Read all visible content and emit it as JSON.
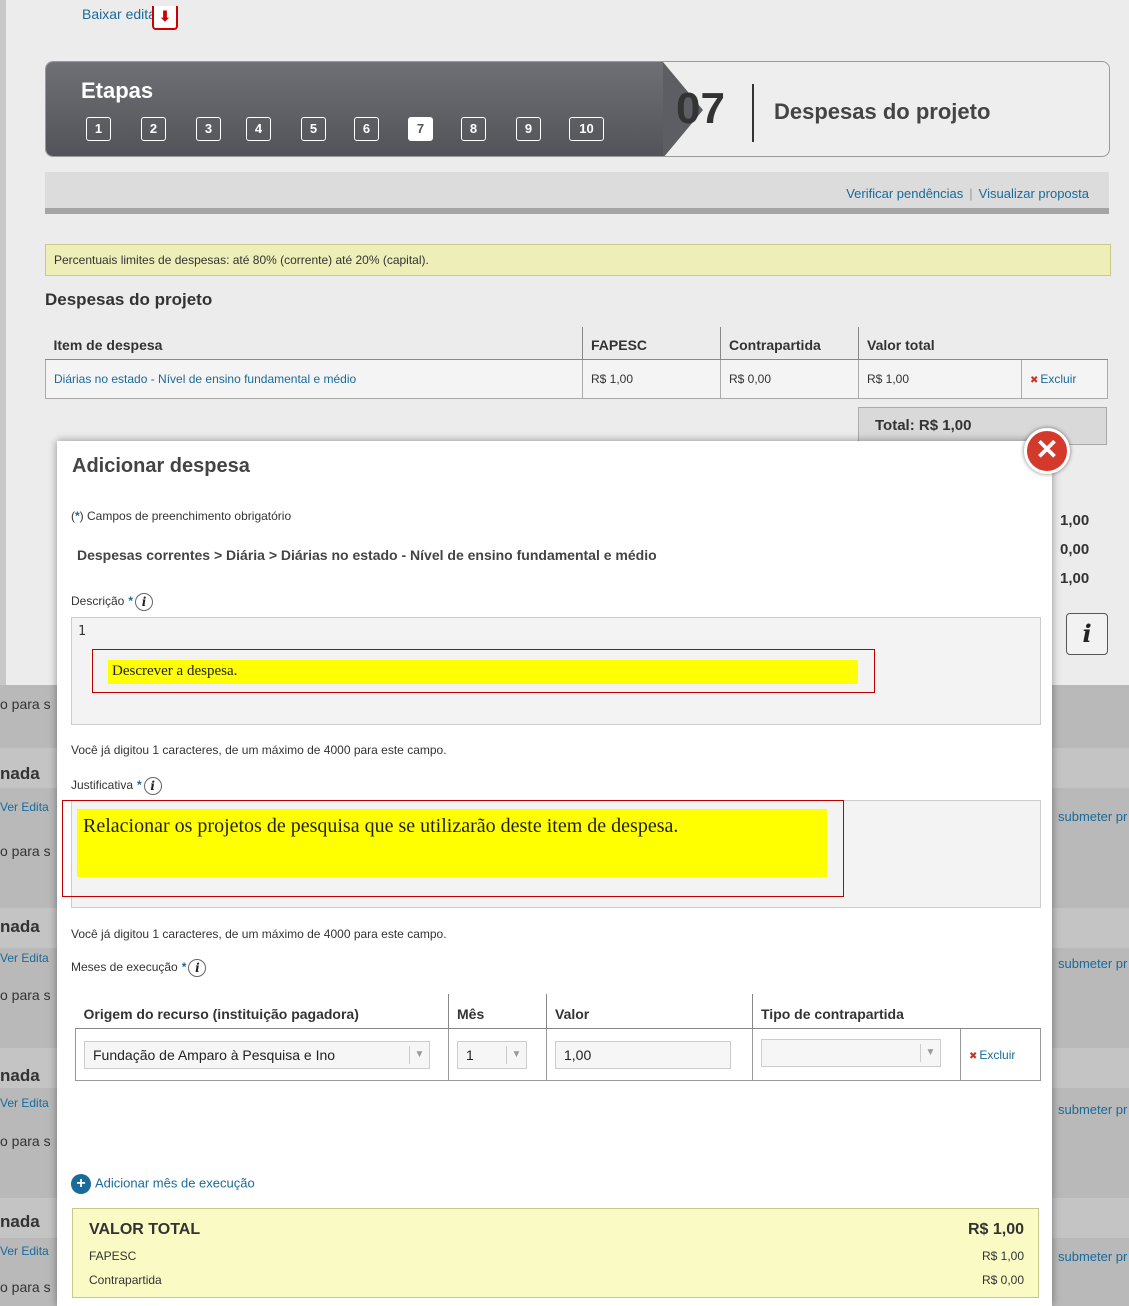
{
  "page": {
    "baixar_edital": "Baixar edital",
    "etapas": {
      "title": "Etapas",
      "steps": [
        "1",
        "2",
        "3",
        "4",
        "5",
        "6",
        "7",
        "8",
        "9",
        "10"
      ],
      "current_number": "07",
      "current_name": "Despesas do projeto"
    },
    "pendencias": {
      "verificar": "Verificar pendências",
      "separator": "|",
      "visualizar": "Visualizar proposta"
    },
    "notice": "Percentuais limites de despesas: até 80% (corrente) até 20% (capital).",
    "section_title": "Despesas do projeto",
    "table": {
      "headers": [
        "Item de despesa",
        "FAPESC",
        "Contrapartida",
        "Valor total"
      ],
      "row": {
        "item": "Diárias no estado - Nível de ensino fundamental e médio",
        "fapesc": "R$ 1,00",
        "contrapartida": "R$ 0,00",
        "valor_total": "R$ 1,00",
        "excluir": "Excluir"
      },
      "total": "Total: R$ 1,00"
    },
    "side_values": [
      "1,00",
      "0,00",
      "1,00"
    ],
    "left_snippets": {
      "para": "o para s",
      "nada": "nada",
      "ver": "Ver Edita"
    },
    "right_snippet": "submeter pr"
  },
  "modal": {
    "title": "Adicionar despesa",
    "required_note": "Campos de preenchimento obrigatório",
    "required_open": "(",
    "required_star": "*",
    "required_close": ")",
    "breadcrumb": "Despesas correntes > Diária > Diárias no estado - Nível de ensino fundamental e médio",
    "descricao": {
      "label": "Descrição",
      "value": "1",
      "hint": "Descrever a despesa.",
      "count": "Você já digitou 1 caracteres, de um máximo de 4000 para este campo."
    },
    "justificativa": {
      "label": "Justificativa",
      "hint": "Relacionar os projetos de pesquisa que se utilizarão deste item de despesa.",
      "count": "Você já digitou 1 caracteres, de um máximo de 4000 para este campo."
    },
    "meses": {
      "label": "Meses de execução",
      "headers": [
        "Origem do recurso (instituição pagadora)",
        "Mês",
        "Valor",
        "Tipo de contrapartida"
      ],
      "row": {
        "origem": "Fundação de Amparo à Pesquisa e Ino",
        "mes": "1",
        "valor": "1,00",
        "tipo": "",
        "excluir": "Excluir"
      },
      "add": "Adicionar mês de execução"
    },
    "valor_total": {
      "label": "VALOR TOTAL",
      "value": "R$ 1,00",
      "fapesc_label": "FAPESC",
      "fapesc_value": "R$ 1,00",
      "contrapartida_label": "Contrapartida",
      "contrapartida_value": "R$ 0,00"
    }
  },
  "colors": {
    "link": "#1a6a9a",
    "notice_bg": "#eeeeb8",
    "hint_fill": "#ffff00",
    "hint_border": "#c00000",
    "close_btn": "#d33a2c"
  }
}
